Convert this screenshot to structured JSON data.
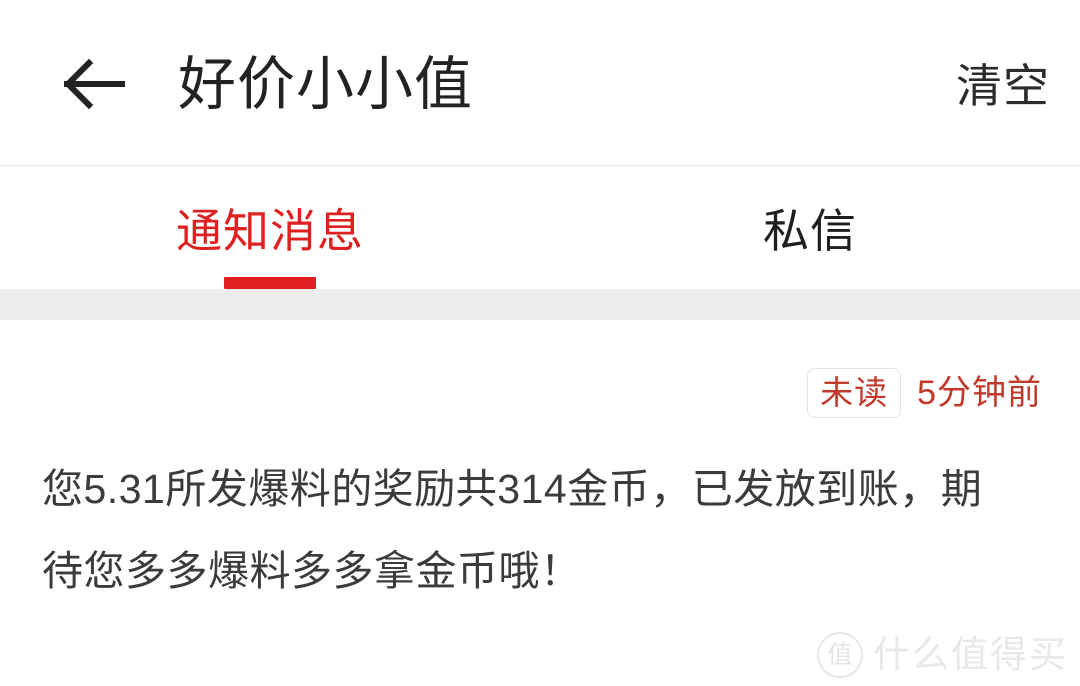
{
  "header": {
    "back_icon": "arrow-left-icon",
    "title": "好价小小值",
    "action_label": "清空"
  },
  "tabs": [
    {
      "label": "通知消息",
      "active": true
    },
    {
      "label": "私信",
      "active": false
    }
  ],
  "notifications": [
    {
      "badge": "未读",
      "time": "5分钟前",
      "text": "您5.31所发爆料的奖励共314金币，已发放到账，期待您多多爆料多多拿金币哦！"
    }
  ],
  "watermark": {
    "mark": "值",
    "text": "什么值得买"
  },
  "colors": {
    "accent_red": "#e02020",
    "badge_red": "#c0392b",
    "text_dark": "#222222",
    "body_text": "#3b3b3b",
    "band_gray": "#ededed",
    "border_gray": "#e9e9e9"
  }
}
